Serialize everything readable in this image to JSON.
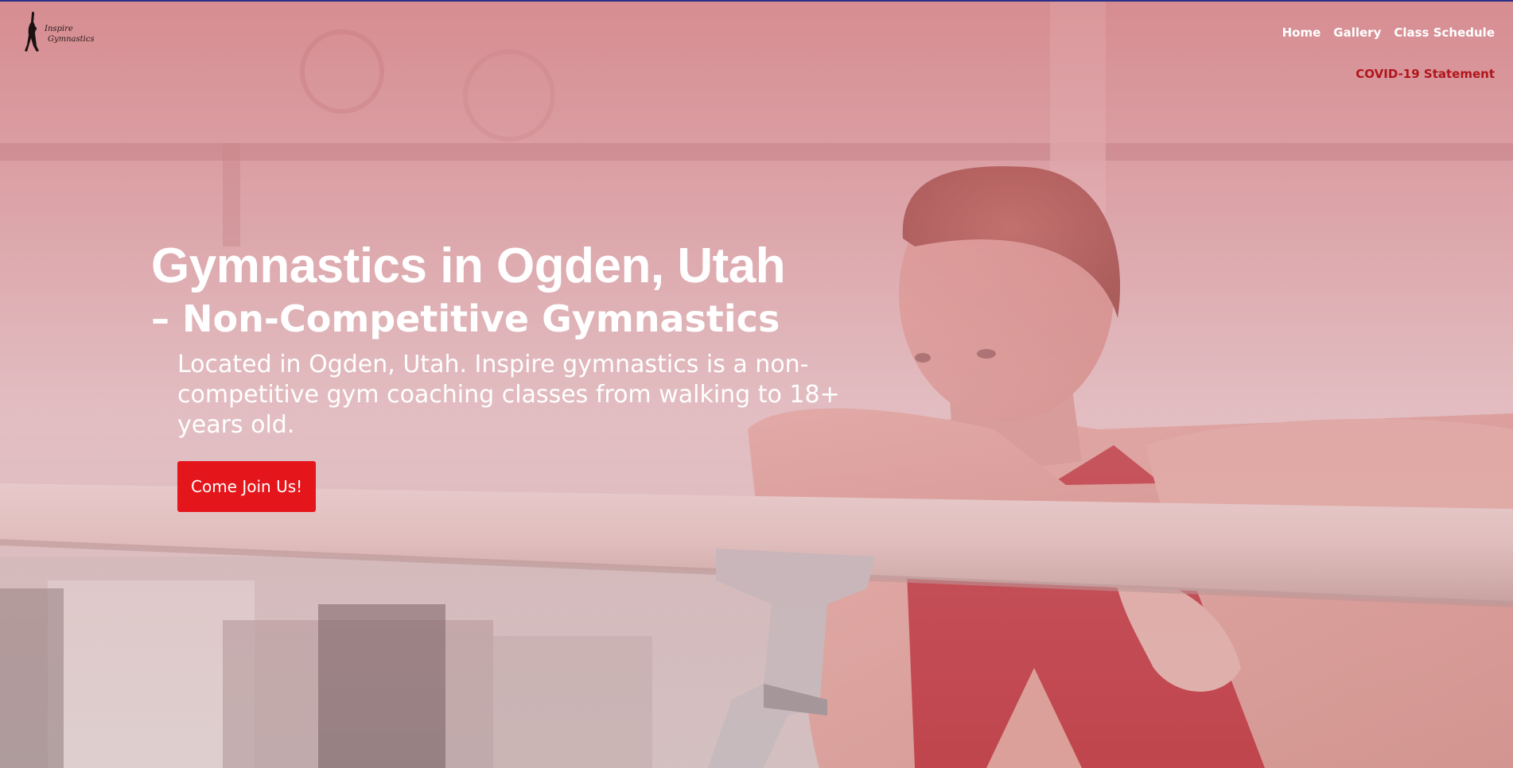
{
  "brand": {
    "logo_alt": "Inspire Gymnastics",
    "logo_line1": "Inspire",
    "logo_line2": "Gymnastics"
  },
  "nav": {
    "items": [
      {
        "label": "Home"
      },
      {
        "label": "Gallery"
      },
      {
        "label": "Class Schedule"
      }
    ],
    "covid_label": "COVID-19 Statement"
  },
  "hero": {
    "title": "Gymnastics in Ogden, Utah",
    "subtitle": "– Non-Competitive Gymnastics",
    "description": "Located in Ogden, Utah. Inspire gymnastics is a non-competitive gym coaching classes from walking to 18+ years old.",
    "cta_label": "Come Join Us!"
  },
  "colors": {
    "accent": "#e4161b",
    "covid_link": "#b0161c",
    "top_rule": "#2b2f86",
    "overlay": "#cd6970"
  }
}
